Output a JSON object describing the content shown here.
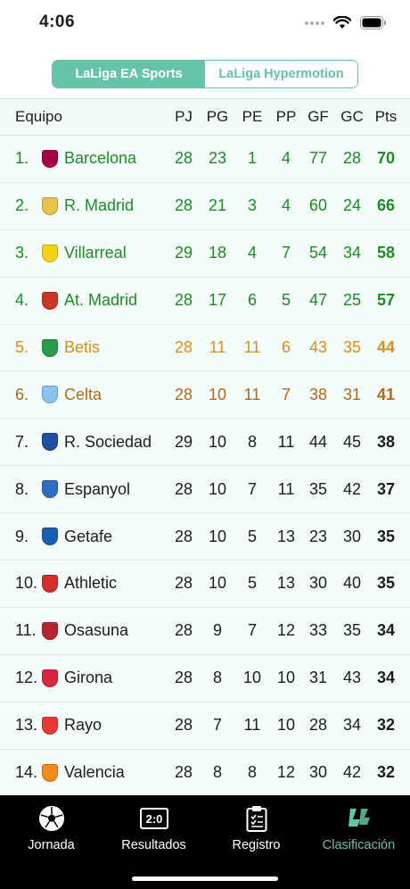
{
  "status": {
    "time": "4:06"
  },
  "tabs_top": [
    {
      "label": "LaLiga EA Sports",
      "active": true
    },
    {
      "label": "LaLiga Hypermotion",
      "active": false
    }
  ],
  "table": {
    "headers": {
      "team": "Equipo",
      "pj": "PJ",
      "pg": "PG",
      "pe": "PE",
      "pp": "PP",
      "gf": "GF",
      "gc": "GC",
      "pts": "Pts"
    },
    "rows": [
      {
        "pos": "1.",
        "name": "Barcelona",
        "pj": "28",
        "pg": "23",
        "pe": "1",
        "pp": "4",
        "gf": "77",
        "gc": "28",
        "pts": "70",
        "tier": "cl",
        "crest": "#a50044"
      },
      {
        "pos": "2.",
        "name": "R. Madrid",
        "pj": "28",
        "pg": "21",
        "pe": "3",
        "pp": "4",
        "gf": "60",
        "gc": "24",
        "pts": "66",
        "tier": "cl",
        "crest": "#e8c14a"
      },
      {
        "pos": "3.",
        "name": "Villarreal",
        "pj": "29",
        "pg": "18",
        "pe": "4",
        "pp": "7",
        "gf": "54",
        "gc": "34",
        "pts": "58",
        "tier": "cl",
        "crest": "#f2d21b"
      },
      {
        "pos": "4.",
        "name": "At. Madrid",
        "pj": "28",
        "pg": "17",
        "pe": "6",
        "pp": "5",
        "gf": "47",
        "gc": "25",
        "pts": "57",
        "tier": "cl",
        "crest": "#cb3524"
      },
      {
        "pos": "5.",
        "name": "Betis",
        "pj": "28",
        "pg": "11",
        "pe": "11",
        "pp": "6",
        "gf": "43",
        "gc": "35",
        "pts": "44",
        "tier": "el",
        "crest": "#2a9d4a"
      },
      {
        "pos": "6.",
        "name": "Celta",
        "pj": "28",
        "pg": "10",
        "pe": "11",
        "pp": "7",
        "gf": "38",
        "gc": "31",
        "pts": "41",
        "tier": "cl2",
        "crest": "#8ac3ee"
      },
      {
        "pos": "7.",
        "name": "R. Sociedad",
        "pj": "29",
        "pg": "10",
        "pe": "8",
        "pp": "11",
        "gf": "44",
        "gc": "45",
        "pts": "38",
        "tier": "none",
        "crest": "#1f4fa0"
      },
      {
        "pos": "8.",
        "name": "Espanyol",
        "pj": "28",
        "pg": "10",
        "pe": "7",
        "pp": "11",
        "gf": "35",
        "gc": "42",
        "pts": "37",
        "tier": "none",
        "crest": "#2d6fc4"
      },
      {
        "pos": "9.",
        "name": "Getafe",
        "pj": "28",
        "pg": "10",
        "pe": "5",
        "pp": "13",
        "gf": "23",
        "gc": "30",
        "pts": "35",
        "tier": "none",
        "crest": "#1a5fb4"
      },
      {
        "pos": "10.",
        "name": "Athletic",
        "pj": "28",
        "pg": "10",
        "pe": "5",
        "pp": "13",
        "gf": "30",
        "gc": "40",
        "pts": "35",
        "tier": "none",
        "crest": "#d22f2f"
      },
      {
        "pos": "11.",
        "name": "Osasuna",
        "pj": "28",
        "pg": "9",
        "pe": "7",
        "pp": "12",
        "gf": "33",
        "gc": "35",
        "pts": "34",
        "tier": "none",
        "crest": "#b5272d"
      },
      {
        "pos": "12.",
        "name": "Girona",
        "pj": "28",
        "pg": "8",
        "pe": "10",
        "pp": "10",
        "gf": "31",
        "gc": "43",
        "pts": "34",
        "tier": "none",
        "crest": "#d7263d"
      },
      {
        "pos": "13.",
        "name": "Rayo",
        "pj": "28",
        "pg": "7",
        "pe": "11",
        "pp": "10",
        "gf": "28",
        "gc": "34",
        "pts": "32",
        "tier": "none",
        "crest": "#e53935"
      },
      {
        "pos": "14.",
        "name": "Valencia",
        "pj": "28",
        "pg": "8",
        "pe": "8",
        "pp": "12",
        "gf": "30",
        "gc": "42",
        "pts": "32",
        "tier": "none",
        "crest": "#f08a1c"
      }
    ]
  },
  "tabbar": [
    {
      "label": "Jornada",
      "icon": "soccer-ball-icon",
      "active": false
    },
    {
      "label": "Resultados",
      "icon": "scoreboard-icon",
      "scoreboard_text": "2:0",
      "active": false
    },
    {
      "label": "Registro",
      "icon": "clipboard-icon",
      "active": false
    },
    {
      "label": "Clasificación",
      "icon": "laliga-logo-icon",
      "active": true
    }
  ],
  "colors": {
    "accent": "#66c2a8",
    "champions": "#1e8a24",
    "europa": "#d4901d",
    "conference": "#b06a1a"
  }
}
